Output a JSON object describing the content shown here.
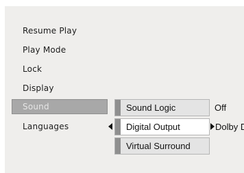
{
  "menu": {
    "items": [
      {
        "label": "Resume Play"
      },
      {
        "label": "Play Mode"
      },
      {
        "label": "Lock"
      },
      {
        "label": "Display"
      },
      {
        "label": "Sound"
      },
      {
        "label": "Languages"
      }
    ]
  },
  "submenu": {
    "items": [
      {
        "label": "Sound Logic",
        "value": "Off"
      },
      {
        "label": "Digital Output",
        "value": "Dolby D"
      },
      {
        "label": "Virtual Surround"
      }
    ]
  },
  "icons": {
    "left_arrow": "left-triangle-arrow",
    "right_arrow": "right-triangle-arrow"
  },
  "colors": {
    "panel_bg": "#efeeec",
    "selected_bg": "#a8a8a8",
    "tab": "#8f8f8f"
  }
}
